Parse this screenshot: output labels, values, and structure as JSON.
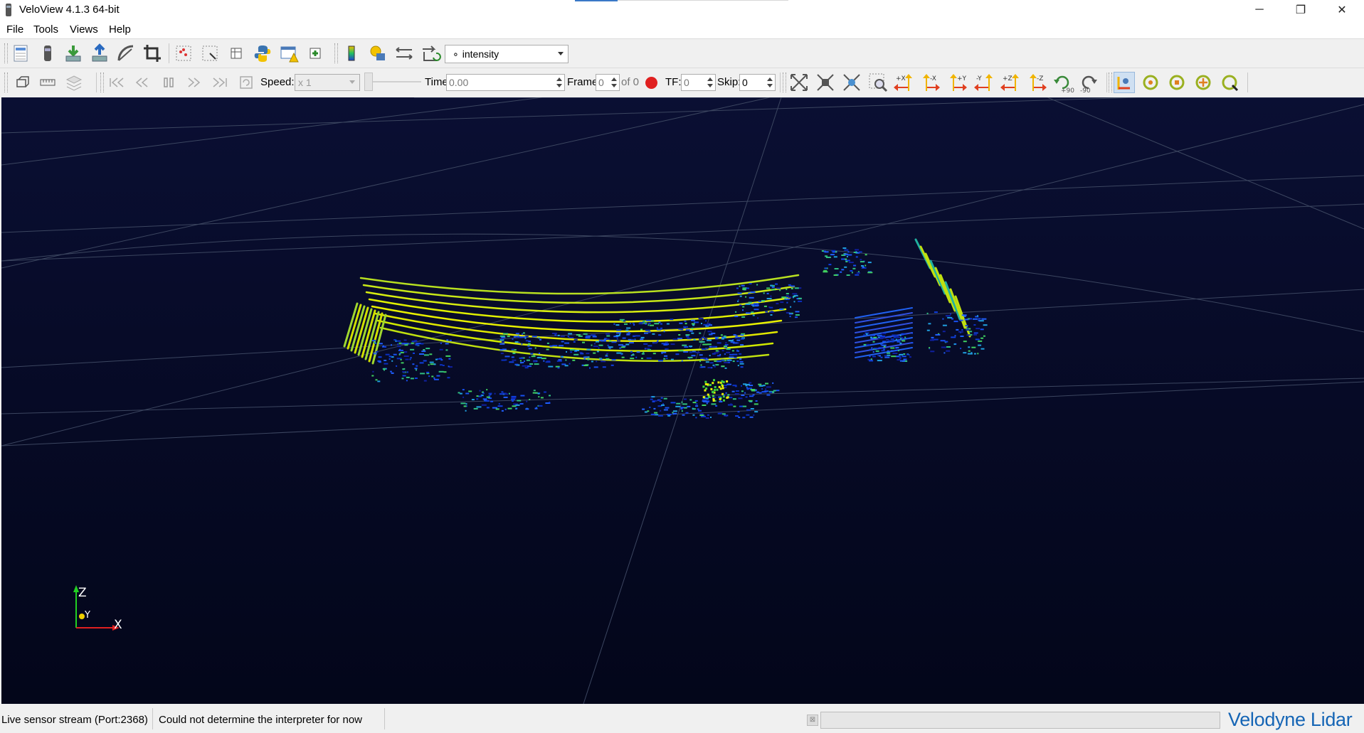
{
  "window": {
    "title": "VeloView 4.1.3 64-bit",
    "controls": {
      "minimize": "─",
      "restore": "❐",
      "close": "✕"
    }
  },
  "menu": {
    "items": [
      "File",
      "Tools",
      "Views",
      "Help"
    ]
  },
  "toolbar_main": {
    "icons": [
      "open-file-icon",
      "open-sensor-icon",
      "save-icon",
      "export-icon",
      "measure-icon",
      "crop-icon",
      "select-points-icon",
      "select-region-icon",
      "spreadsheet-icon",
      "python-icon",
      "warning-window-icon",
      "add-icon"
    ],
    "color_by": {
      "selected": "intensity",
      "bullet": "∘"
    },
    "icons_right": [
      "color-legend-icon",
      "cube-axes-icon",
      "calibration-icon",
      "reset-transform-icon"
    ]
  },
  "toolbar_playback": {
    "speed_label": "Speed:",
    "speed_value": "x 1",
    "time_label": "Time",
    "time_value": "0.00",
    "frame_label": "Frame",
    "frame_value": "0",
    "frame_total": "of 0",
    "tf_label": "TF:",
    "tf_value": "0",
    "skip_label": "Skip:",
    "skip_value": "0",
    "record_color": "#e02020"
  },
  "toolbar_camera": {
    "axis_labels": [
      "+X",
      "-X",
      "+Y",
      "-Y",
      "+Z",
      "-Z"
    ],
    "rotate_labels": [
      "+90",
      "-90"
    ],
    "arrow_colors": {
      "up": "#f0b400",
      "side": "#e04020"
    }
  },
  "viewport": {
    "axes": {
      "z": "Z",
      "y": "Y",
      "x": "X"
    },
    "background": "#070b28"
  },
  "status": {
    "stream": "Live sensor stream (Port:2368)",
    "message": "Could not determine the interpreter for now",
    "cancel": "⊠"
  },
  "brand": {
    "text": "Velodyne Lidar",
    "color": "#1565b5"
  }
}
